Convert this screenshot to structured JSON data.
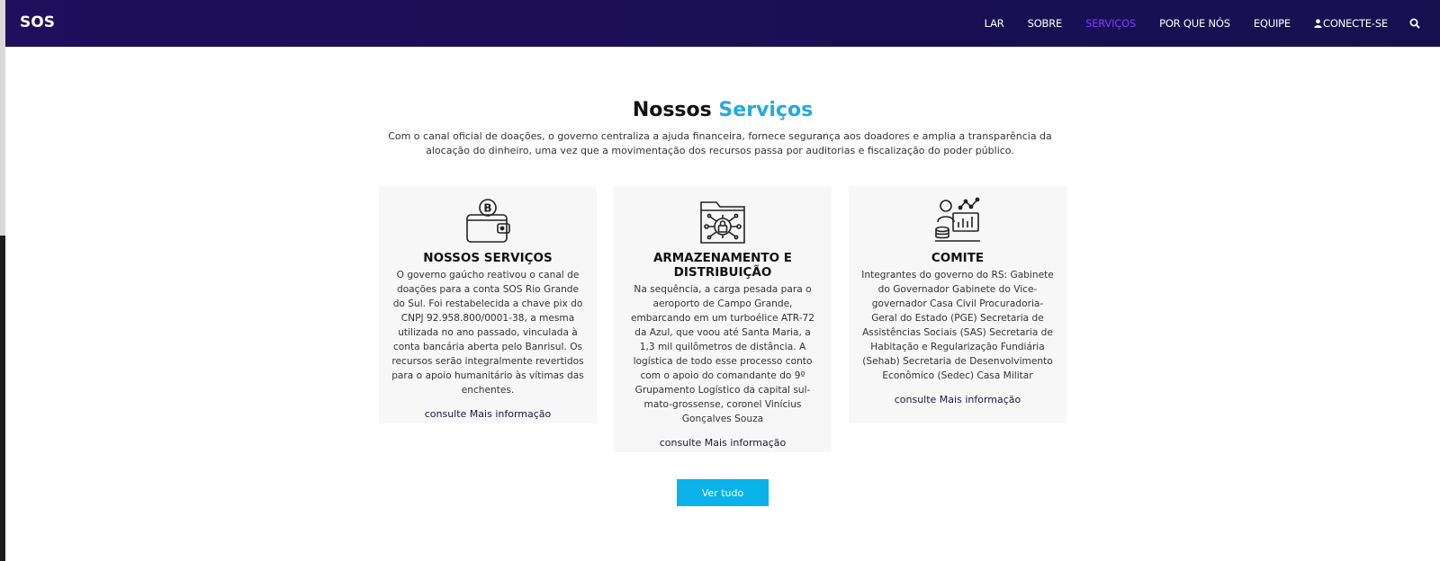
{
  "brand": "SOS",
  "nav": {
    "items": [
      "LAR",
      "SOBRE",
      "SERVIÇOS",
      "POR QUE NÓS",
      "EQUIPE",
      "CONECTE-SE"
    ],
    "active_color": "#7b3cff"
  },
  "section": {
    "title_main": "Nossos",
    "title_accent": "Serviços",
    "intro": "Com o canal oficial de doações, o governo centraliza a ajuda financeira, fornece segurança aos doadores e amplia a transparência da alocação do dinheiro, uma vez que a movimentação dos recursos passa por auditorias e fiscalização do poder público."
  },
  "cards": [
    {
      "icon": "bitcoin-wallet-icon",
      "title": "NOSSOS SERVIÇOS",
      "text": "O governo gaúcho reativou o canal de doações para a conta SOS Rio Grande do Sul. Foi restabelecida a chave pix do CNPJ 92.958.800/0001-38, a mesma utilizada no ano passado, vinculada à conta bancária aberta pelo Banrisul. Os recursos serão integralmente revertidos para o apoio humanitário às vítimas das enchentes.",
      "link": "consulte Mais informação"
    },
    {
      "icon": "secure-folder-network-icon",
      "title": "ARMAZENAMENTO E DISTRIBUIÇÃO",
      "text": "Na sequência, a carga pesada para o aeroporto de Campo Grande, embarcando em um turboélice ATR-72 da Azul, que voou até Santa Maria, a 1,3 mil quilômetros de distância. A logística de todo esse processo conto com o apoio do comandante do 9º Grupamento Logístico da capital sul-mato-grossense, coronel Vinícius Gonçalves Souza",
      "link": "consulte Mais informação"
    },
    {
      "icon": "analyst-dashboard-icon",
      "title": "COMITE",
      "text": "Integrantes do governo do RS: Gabinete do Governador Gabinete do Vice-governador Casa Civil Procuradoria-Geral do Estado (PGE) Secretaria de Assistências Sociais (SAS) Secretaria de Habitação e Regularização Fundiária (Sehab) Secretaria de Desenvolvimento Econômico (Sedec) Casa Militar",
      "link": "consulte Mais informação"
    }
  ],
  "button_all": "Ver tudo",
  "colors": {
    "navbar": "#1c0f58",
    "accent_title": "#25a9e0",
    "button": "#09b3e9",
    "card_bg": "#f7f7f7"
  }
}
